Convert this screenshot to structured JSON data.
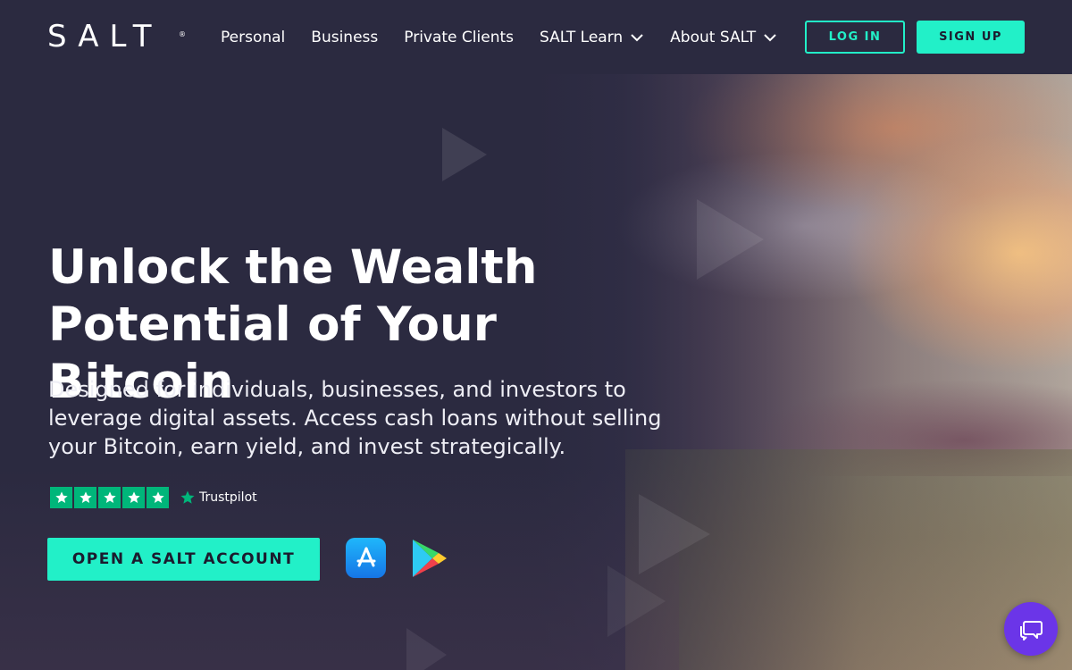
{
  "brand": {
    "logo_text": "SALT",
    "trademark": "®"
  },
  "nav": {
    "items": [
      {
        "label": "Personal",
        "has_dropdown": false
      },
      {
        "label": "Business",
        "has_dropdown": false
      },
      {
        "label": "Private Clients",
        "has_dropdown": false
      },
      {
        "label": "SALT Learn",
        "has_dropdown": true
      },
      {
        "label": "About SALT",
        "has_dropdown": true
      }
    ],
    "login_label": "LOG IN",
    "signup_label": "SIGN UP"
  },
  "hero": {
    "headline_line1": "Unlock the Wealth",
    "headline_line2": "Potential of Your Bitcoin",
    "subtext": "Designed for individuals, businesses, and investors to leverage digital assets. Access cash loans without selling your Bitcoin, earn yield, and invest strategically.",
    "trustpilot": {
      "label": "Trustpilot",
      "stars": 5
    },
    "cta_label": "OPEN A SALT ACCOUNT"
  },
  "icons": {
    "app_store": "app-store-icon",
    "google_play": "google-play-icon",
    "chat": "chat-icon"
  },
  "colors": {
    "accent": "#22f0c8",
    "header_bg": "#2b2a40",
    "trustpilot_green": "#00b67a",
    "chat_purple": "#6b35e8"
  }
}
